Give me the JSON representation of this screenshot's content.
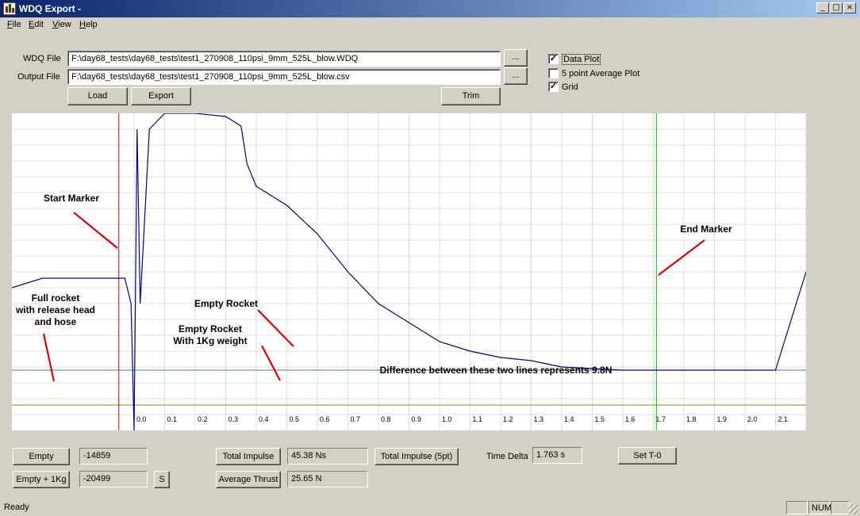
{
  "window": {
    "title": "WDQ Export  -"
  },
  "menu": [
    "File",
    "Edit",
    "View",
    "Help"
  ],
  "files": {
    "wdq_label": "WDQ File",
    "wdq_value": "F:\\day68_tests\\day68_tests\\test1_270908_110psi_9mm_525L_blow.WDQ",
    "output_label": "Output File",
    "output_value": "F:\\day68_tests\\day68_tests\\test1_270908_110psi_9mm_525L_blow.csv",
    "browse_label": "..."
  },
  "buttons": {
    "load": "Load",
    "export": "Export",
    "trim": "Trim"
  },
  "options": [
    {
      "label": "Data Plot",
      "checked": true
    },
    {
      "label": "5 point Average Plot",
      "checked": false
    },
    {
      "label": "Grid",
      "checked": true
    }
  ],
  "chart_data": {
    "type": "line",
    "x_ticks": [
      "0.0",
      "0.1",
      "0.2",
      "0.3",
      "0.4",
      "0.5",
      "0.6",
      "0.7",
      "0.8",
      "0.9",
      "1.0",
      "1.1",
      "1.2",
      "1.3",
      "1.4",
      "1.5",
      "1.6",
      "1.7",
      "1.8",
      "1.9",
      "2.0",
      "2.1",
      "2"
    ],
    "xlim": [
      -0.4,
      2.2
    ],
    "grid": true,
    "series": [
      {
        "color": "#00008b",
        "x": [
          -0.4,
          -0.3,
          -0.2,
          -0.1,
          -0.03,
          -0.01,
          0.0,
          0.01,
          0.02,
          0.05,
          0.1,
          0.2,
          0.3,
          0.35,
          0.37,
          0.4,
          0.5,
          0.6,
          0.7,
          0.8,
          0.9,
          1.0,
          1.1,
          1.2,
          1.3,
          1.4,
          1.5,
          1.6,
          1.7,
          1.8,
          1.9,
          2.0,
          2.1,
          2.2
        ],
        "y": [
          0.45,
          0.48,
          0.48,
          0.48,
          0.48,
          0.4,
          0.0,
          0.95,
          0.4,
          0.95,
          1.0,
          1.0,
          0.99,
          0.96,
          0.84,
          0.77,
          0.71,
          0.62,
          0.5,
          0.4,
          0.34,
          0.28,
          0.25,
          0.23,
          0.22,
          0.2,
          0.195,
          0.19,
          0.19,
          0.19,
          0.19,
          0.19,
          0.19,
          0.5
        ]
      }
    ],
    "markers": {
      "start": -0.05,
      "end": 1.71
    },
    "reference_lines": {
      "empty_rocket": 0.19,
      "empty_rocket_1kg": 0.08
    },
    "annotations": [
      {
        "id": "start",
        "text": "Start Marker"
      },
      {
        "id": "end",
        "text": "End Marker"
      },
      {
        "id": "full",
        "line1": "Full rocket",
        "line2": "with release head",
        "line3": "and hose"
      },
      {
        "id": "empty",
        "text": "Empty Rocket"
      },
      {
        "id": "empty1kg",
        "line1": "Empty Rocket",
        "line2": "With 1Kg weight"
      },
      {
        "id": "diff",
        "text": "Difference between these two lines represents 9.8N"
      }
    ],
    "colors": {
      "start_marker": "#d00000",
      "end_marker": "#00c000",
      "empty_line": "#2e8b8b",
      "weight_line": "#8b8b00",
      "arrow": "#e00000"
    }
  },
  "results": {
    "empty_btn": "Empty",
    "empty_val": "-14859",
    "empty1kg_btn": "Empty + 1Kg",
    "empty1kg_val": "-20499",
    "s_btn": "S",
    "total_impulse_btn": "Total Impulse",
    "total_impulse_val": "45.38 Ns",
    "avg_thrust_btn": "Average Thrust",
    "avg_thrust_val": "25.65 N",
    "total_impulse_5pt_btn": "Total Impulse (5pt)",
    "time_delta_label": "Time Delta",
    "time_delta_val": "1.763 s",
    "set_t0_btn": "Set T-0"
  },
  "status": {
    "text": "Ready",
    "num": "NUM"
  }
}
